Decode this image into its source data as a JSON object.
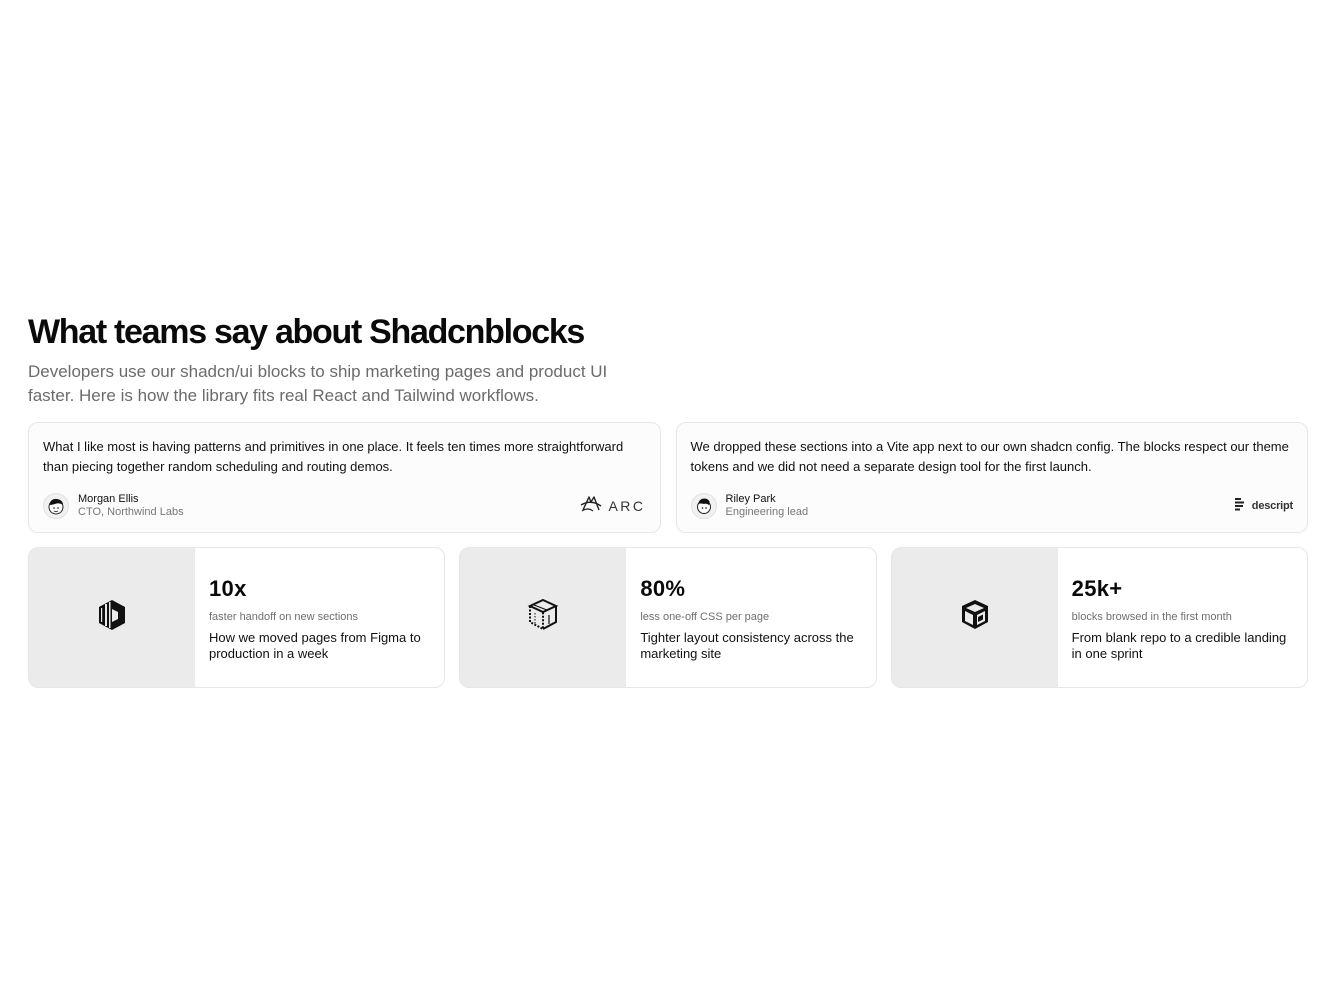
{
  "header": {
    "title": "What teams say about Shadcnblocks",
    "subtitle": "Developers use our shadcn/ui blocks to ship marketing pages and product UI faster. Here is how the library fits real React and Tailwind workflows."
  },
  "testimonials": [
    {
      "quote": "What I like most is having patterns and primitives in one place. It feels ten times more straightforward than piecing together random scheduling and routing demos.",
      "name": "Morgan Ellis",
      "role": "CTO, Northwind Labs",
      "logo_icon": "arc-logo-icon",
      "logo_text": "ARC"
    },
    {
      "quote": "We dropped these sections into a Vite app next to our own shadcn config. The blocks respect our theme tokens and we did not need a separate design tool for the first launch.",
      "name": "Riley Park",
      "role": "Engineering lead",
      "logo_icon": "descript-logo-icon",
      "logo_text": "descript"
    }
  ],
  "stats": [
    {
      "icon": "hexagon-cube-icon",
      "value": "10x",
      "label": "faster handoff on new sections",
      "description": "How we moved pages from Figma to production in a week"
    },
    {
      "icon": "dotted-cube-icon",
      "value": "80%",
      "label": "less one-off CSS per page",
      "description": "Tighter layout consistency across the marketing site"
    },
    {
      "icon": "box-cube-icon",
      "value": "25k+",
      "label": "blocks browsed in the first month",
      "description": "From blank repo to a credible landing in one sprint"
    }
  ],
  "colors": {
    "text": "#0a0a0a",
    "muted": "#6b6b6b",
    "border": "#e6e6e6",
    "media_bg": "#ebebeb"
  }
}
